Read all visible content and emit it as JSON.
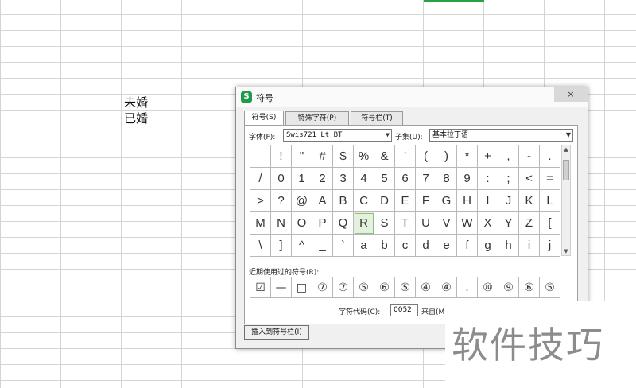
{
  "sheet": {
    "cells": [
      "未婚",
      "已婚"
    ],
    "selection_color": "#27a243"
  },
  "dialog": {
    "title": "符号",
    "app_icon": "S",
    "close_glyph": "×",
    "tabs": [
      {
        "label": "符号(S)",
        "active": true
      },
      {
        "label": "特殊字符(P)",
        "active": false
      },
      {
        "label": "符号栏(T)",
        "active": false
      }
    ],
    "font_label": "字体(F):",
    "font_value": "Swis721 Lt BT",
    "subset_label": "子集(U):",
    "subset_value": "基本拉丁语",
    "symbols": [
      "",
      "!",
      "\"",
      "#",
      "$",
      "%",
      "&",
      "'",
      "(",
      ")",
      "*",
      "+",
      ",",
      "-",
      ".",
      "/",
      "0",
      "1",
      "2",
      "3",
      "4",
      "5",
      "6",
      "7",
      "8",
      "9",
      ":",
      ";",
      "<",
      "=",
      ">",
      "?",
      "@",
      "A",
      "B",
      "C",
      "D",
      "E",
      "F",
      "G",
      "H",
      "I",
      "J",
      "K",
      "L",
      "M",
      "N",
      "O",
      "P",
      "Q",
      "R",
      "S",
      "T",
      "U",
      "V",
      "W",
      "X",
      "Y",
      "Z",
      "[",
      "\\",
      "]",
      "^",
      "_",
      "`",
      "a",
      "b",
      "c",
      "d",
      "e",
      "f",
      "g",
      "h",
      "i",
      "j"
    ],
    "selected_symbol": "R",
    "recent_label": "近期使用过的符号(R):",
    "recent_symbols": [
      "☑",
      "—",
      "□",
      "⑦",
      "⑦",
      "⑤",
      "⑥",
      "⑤",
      "④",
      "④",
      ".",
      "⑩",
      "⑨",
      "⑥",
      "⑤"
    ],
    "code_label": "字符代码(C):",
    "code_value": "0052",
    "from_label": "来自(M)",
    "insert_button": "插入到符号栏(I)"
  },
  "watermark": "软件技巧"
}
